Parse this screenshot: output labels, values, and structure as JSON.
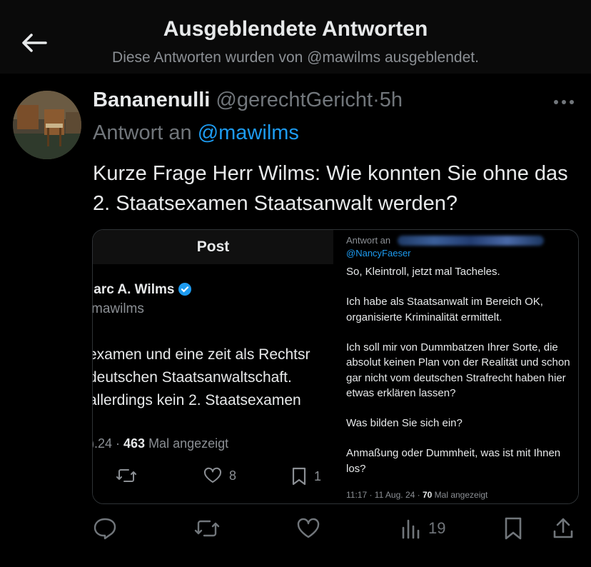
{
  "header": {
    "title": "Ausgeblendete Antworten",
    "subtitle": "Diese Antworten wurden von @mawilms ausgeblendet."
  },
  "tweet": {
    "display_name": "Bananenulli",
    "handle": "@gerechtGericht",
    "separator": "·",
    "time": "5h",
    "reply_prefix": "Antwort an",
    "reply_mention": "@mawilms",
    "body": "Kurze Frage Herr Wilms: Wie konnten Sie ohne das 2. Staatsexamen Staatsanwalt werden?"
  },
  "embedded_left": {
    "title": "Post",
    "name": "larc A. Wilms",
    "handle": "mawilms",
    "lines": [
      "examen und eine zeit als Rechtsr",
      "deutschen Staatsanwaltschaft.",
      "allerdings kein 2. Staatsexamen"
    ],
    "stats_date": ").24 · ",
    "views": "463",
    "views_label": " Mal angezeigt",
    "likes": "8",
    "bookmarks": "1"
  },
  "embedded_right": {
    "reply_prefix": "Antwort an",
    "mention": "@NancyFaeser",
    "paragraphs": [
      "So, Kleintroll, jetzt mal Tacheles.",
      "Ich habe als Staatsanwalt im Bereich OK, organisierte Kriminalität ermittelt.",
      "Ich soll mir von Dummbatzen Ihrer Sorte, die absolut keinen Plan von der Realität und schon gar nicht vom deutschen Strafrecht haben hier etwas erklären lassen?",
      "Was bilden Sie sich ein?",
      "Anmaßung oder Dummheit, was ist mit Ihnen los?"
    ],
    "footer_time": "11:17 · 11 Aug. 24 · ",
    "footer_views": "70",
    "footer_label": " Mal angezeigt"
  },
  "actions": {
    "views_count": "19"
  },
  "colors": {
    "accent": "#1d9bf0",
    "muted": "#71767b",
    "text": "#e7e9ea",
    "background": "#000000"
  }
}
